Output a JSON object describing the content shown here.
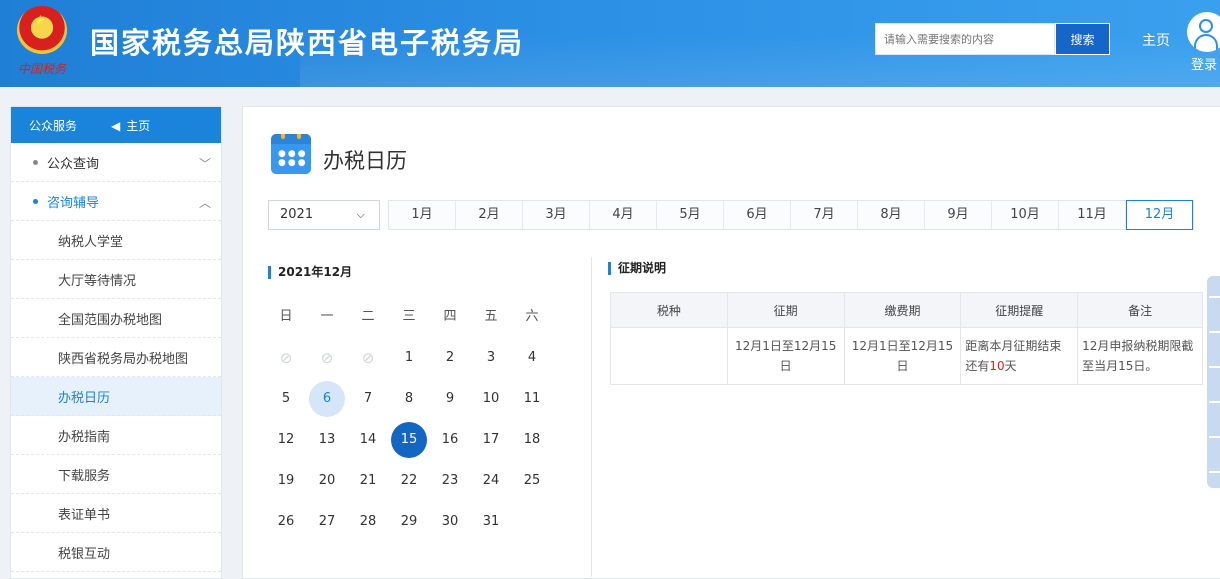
{
  "header": {
    "site_title": "国家税务总局陕西省电子税务局",
    "emblem_text": "中国税务",
    "search_placeholder": "请输入需要搜索的内容",
    "search_button": "搜索",
    "home": "主页",
    "login": "登录"
  },
  "sidebar": {
    "head_label": "公众服务",
    "home_label": "主页",
    "items": [
      {
        "label": "公众查询",
        "type": "group",
        "state": "collapsed"
      },
      {
        "label": "咨询辅导",
        "type": "group",
        "state": "open"
      },
      {
        "label": "纳税人学堂",
        "type": "sub"
      },
      {
        "label": "大厅等待情况",
        "type": "sub"
      },
      {
        "label": "全国范围办税地图",
        "type": "sub"
      },
      {
        "label": "陕西省税务局办税地图",
        "type": "sub"
      },
      {
        "label": "办税日历",
        "type": "sub",
        "active": true
      },
      {
        "label": "办税指南",
        "type": "sub"
      },
      {
        "label": "下载服务",
        "type": "sub"
      },
      {
        "label": "表证单书",
        "type": "sub"
      },
      {
        "label": "税银互动",
        "type": "sub"
      }
    ]
  },
  "main": {
    "title": "办税日历",
    "year": "2021",
    "months": [
      "1月",
      "2月",
      "3月",
      "4月",
      "5月",
      "6月",
      "7月",
      "8月",
      "9月",
      "10月",
      "11月",
      "12月"
    ],
    "selected_month": "12月",
    "calendar": {
      "title": "2021年12月",
      "weekdays": [
        "日",
        "一",
        "二",
        "三",
        "四",
        "五",
        "六"
      ],
      "leading_disabled": 3,
      "days": [
        1,
        2,
        3,
        4,
        5,
        6,
        7,
        8,
        9,
        10,
        11,
        12,
        13,
        14,
        15,
        16,
        17,
        18,
        19,
        20,
        21,
        22,
        23,
        24,
        25,
        26,
        27,
        28,
        29,
        30,
        31
      ],
      "today": 6,
      "deadline": 15
    },
    "period": {
      "title": "征期说明",
      "headers": [
        "税种",
        "征期",
        "缴费期",
        "征期提醒",
        "备注"
      ],
      "rows": [
        {
          "tax": "",
          "period": "12月1日至12月15日",
          "payment": "12月1日至12月15日",
          "reminder_prefix": "距离本月征期结束还有",
          "reminder_days": "10",
          "reminder_suffix": "天",
          "note": "12月申报纳税期限截至当月15日。"
        }
      ]
    }
  },
  "colors": {
    "accent": "#1a83dc",
    "header_bg": "#2b8fe4",
    "deadline": "#1466c3",
    "today": "#d4e6f7",
    "warn": "#e2231a"
  }
}
